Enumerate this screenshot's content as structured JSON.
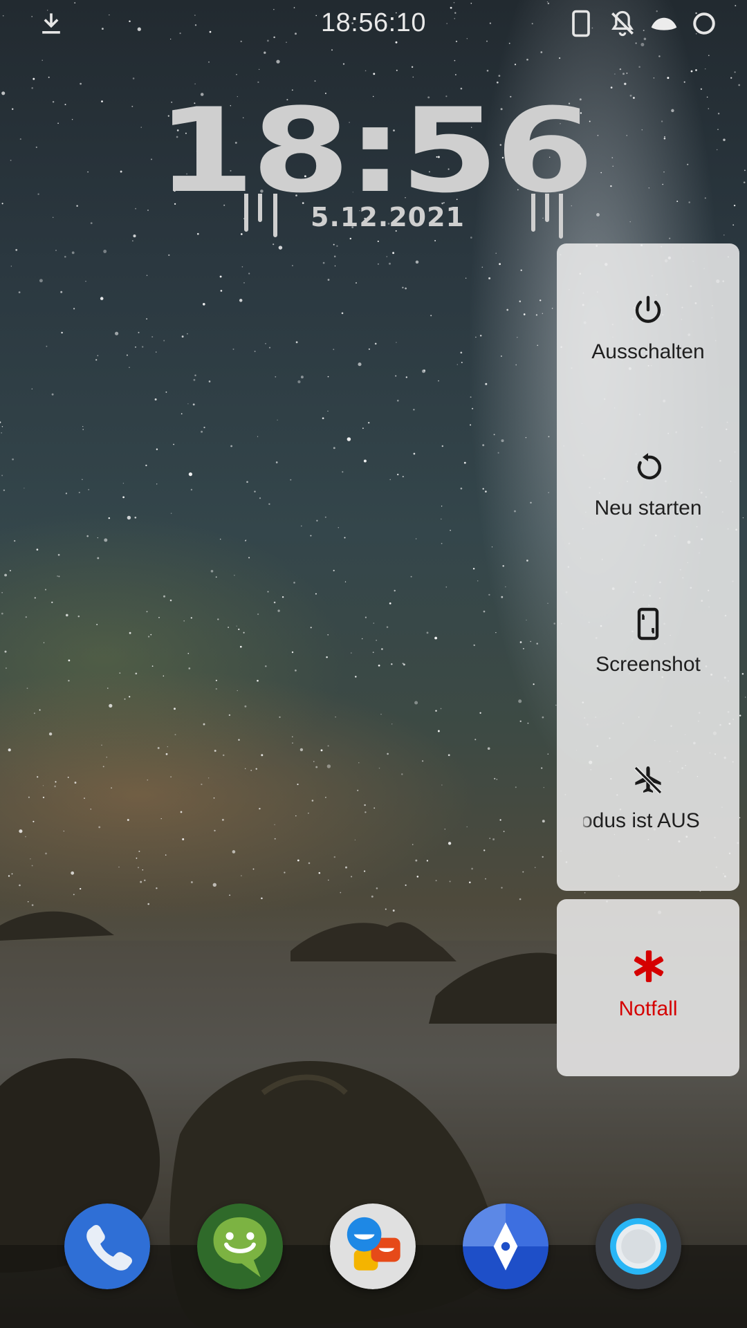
{
  "status_bar": {
    "time": "18:56:10",
    "left_icons": [
      "download-icon"
    ],
    "right_icons": [
      "phone-icon",
      "notifications-off-icon",
      "wifi-icon",
      "battery-ring-icon"
    ]
  },
  "clock_widget": {
    "time": "18:56",
    "date": "5.12.2021"
  },
  "power_menu": {
    "items": [
      {
        "label": "Ausschalten",
        "icon": "power-icon"
      },
      {
        "label": "Neu starten",
        "icon": "restart-icon"
      },
      {
        "label": "Screenshot",
        "icon": "screenshot-icon"
      },
      {
        "label": "modus ist AUS",
        "icon": "airplane-off-icon"
      }
    ],
    "emergency": {
      "label": "Notfall",
      "icon": "emergency-asterisk-icon",
      "color": "#d50000"
    }
  },
  "dock": {
    "apps": [
      "phone-app-icon",
      "messenger-app-icon",
      "chat-app-icon",
      "maps-app-icon",
      "camera-app-icon"
    ]
  },
  "colors": {
    "panel_bg": "#ececec",
    "accent_red": "#d50000",
    "clock_text": "#cfcfcf"
  }
}
